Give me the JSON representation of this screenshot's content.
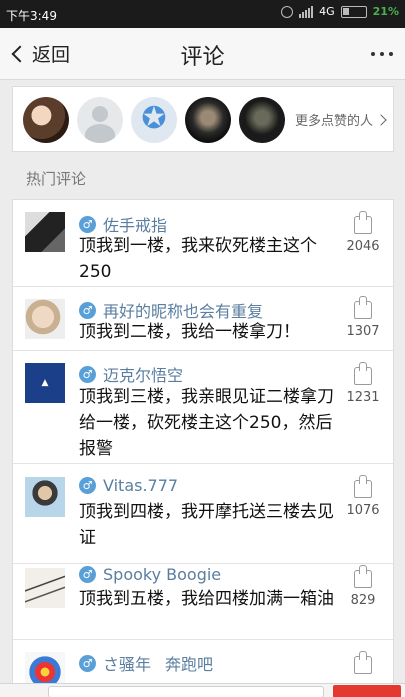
{
  "status_bar": {
    "time": "下午3:49",
    "network": "4G",
    "battery": "21%"
  },
  "nav": {
    "back_label": "返回",
    "title": "评论"
  },
  "likes": {
    "more_label": "更多点赞的人"
  },
  "section": {
    "hot_comments": "热门评论"
  },
  "comments": [
    {
      "username": "佐手戒指",
      "text": "顶我到一楼，我来砍死楼主这个250",
      "likes": "2046"
    },
    {
      "username": "再好的昵称也会有重复",
      "text": "顶我到二楼，我给一楼拿刀！",
      "likes": "1307"
    },
    {
      "username": "迈克尔悟空",
      "text": "顶我到三楼，我亲眼见证二楼拿刀给一楼，砍死楼主这个250，然后报警",
      "likes": "1231"
    },
    {
      "username": "Vitas.777",
      "text": "顶我到四楼，我开摩托送三楼去见证",
      "likes": "1076"
    },
    {
      "username": "Spooky Boogie",
      "text": "顶我到五楼，我给四楼加满一箱油",
      "likes": "829"
    },
    {
      "username": "さ骚年",
      "username_extra": "奔跑吧",
      "text": "",
      "likes": ""
    }
  ],
  "colors": {
    "accent_blue": "#5a7ea0",
    "gender_blue": "#5aa0d8",
    "status_green": "#4caf50"
  }
}
